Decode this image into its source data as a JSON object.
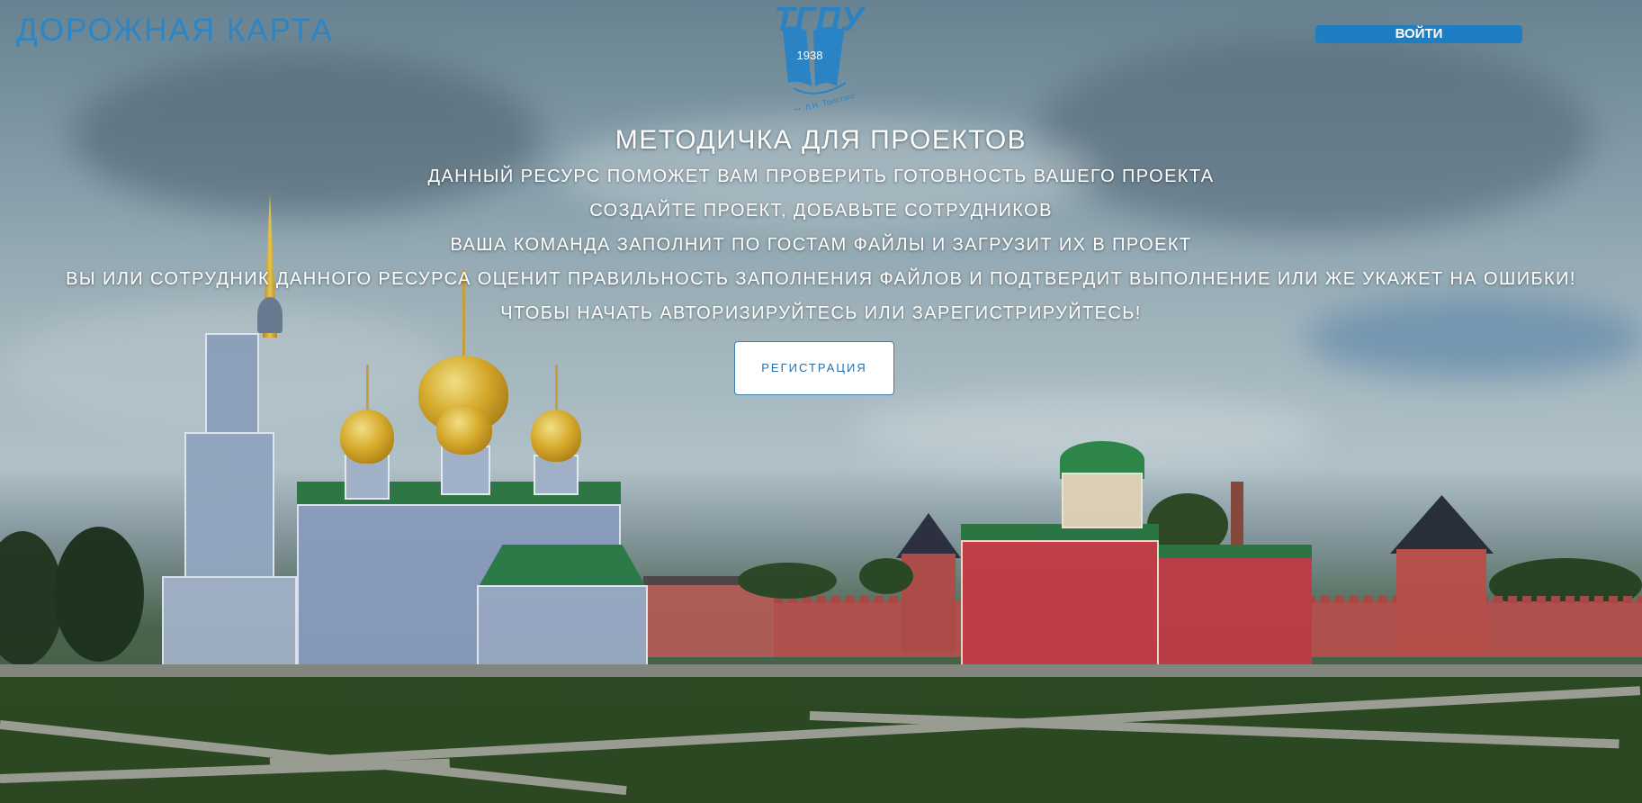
{
  "header": {
    "brand": "ДОРОЖНАЯ КАРТА",
    "login_label": "ВОЙТИ",
    "logo": {
      "text": "ТГПУ",
      "year": "1938",
      "caption": "им. Л.Н. Толстого"
    }
  },
  "main": {
    "title": "МЕТОДИЧКА ДЛЯ ПРОЕКТОВ",
    "lines": [
      "ДАННЫЙ РЕСУРС ПОМОЖЕТ ВАМ ПРОВЕРИТЬ ГОТОВНОСТЬ ВАШЕГО ПРОЕКТА",
      "СОЗДАЙТЕ ПРОЕКТ, ДОБАВЬТЕ СОТРУДНИКОВ",
      "ВАША КОМАНДА ЗАПОЛНИТ ПО ГОСТАМ ФАЙЛЫ И ЗАГРУЗИТ ИХ В ПРОЕКТ",
      "ВЫ ИЛИ СОТРУДНИК ДАННОГО РЕСУРСА ОЦЕНИТ ПРАВИЛЬНОСТЬ ЗАПОЛНЕНИЯ ФАЙЛОВ И ПОДТВЕРДИТ ВЫПОЛНЕНИЕ ИЛИ ЖЕ УКАЖЕТ НА ОШИБКИ!",
      "ЧТОБЫ НАЧАТЬ АВТОРИЗИРУЙТЕСЬ ИЛИ ЗАРЕГИСТРИРУЙТЕСЬ!"
    ],
    "register_label": "РЕГИСТРАЦИЯ"
  },
  "colors": {
    "accent": "#1f7ec2",
    "brand_text": "#2c86c5",
    "hero_text": "#ffffff"
  }
}
